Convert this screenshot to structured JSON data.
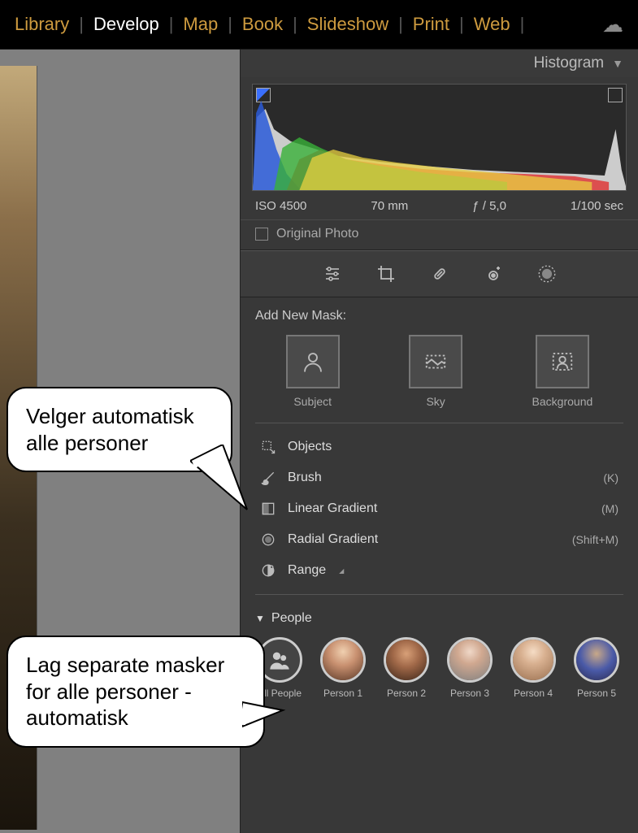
{
  "nav": {
    "library": "Library",
    "develop": "Develop",
    "map": "Map",
    "book": "Book",
    "slideshow": "Slideshow",
    "print": "Print",
    "web": "Web"
  },
  "panel": {
    "histogram_title": "Histogram",
    "meta": {
      "iso": "ISO 4500",
      "focal": "70 mm",
      "aperture": "ƒ / 5,0",
      "shutter": "1/100 sec"
    },
    "original_label": "Original Photo",
    "add_mask_label": "Add New Mask:",
    "masks": {
      "subject": "Subject",
      "sky": "Sky",
      "background": "Background"
    },
    "tools": {
      "objects": "Objects",
      "brush": "Brush",
      "brush_short": "(K)",
      "linear": "Linear Gradient",
      "linear_short": "(M)",
      "radial": "Radial Gradient",
      "radial_short": "(Shift+M)",
      "range": "Range"
    },
    "people_header": "People",
    "people": [
      {
        "label": "All People"
      },
      {
        "label": "Person 1"
      },
      {
        "label": "Person 2"
      },
      {
        "label": "Person 3"
      },
      {
        "label": "Person 4"
      },
      {
        "label": "Person 5"
      }
    ]
  },
  "callouts": {
    "c1": "Velger automatisk alle personer",
    "c2": "Lag separate masker for alle personer - automatisk"
  }
}
